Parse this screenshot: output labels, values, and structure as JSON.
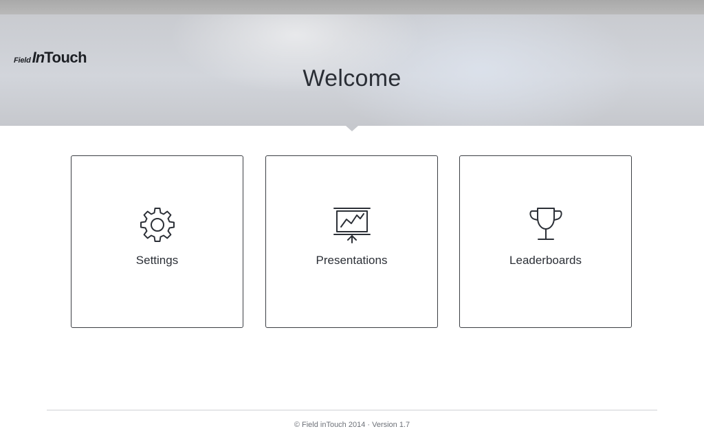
{
  "header": {
    "logo": {
      "field": "Field",
      "in": "In",
      "touch": "Touch"
    },
    "title": "Welcome"
  },
  "tiles": [
    {
      "label": "Settings",
      "icon": "gear-icon"
    },
    {
      "label": "Presentations",
      "icon": "presentation-chart-icon"
    },
    {
      "label": "Leaderboards",
      "icon": "trophy-icon"
    }
  ],
  "footer": {
    "text": "© Field inTouch 2014 · Version 1.7"
  },
  "colors": {
    "text": "#2b2f36",
    "tile_border": "#3a3d42",
    "footer_text": "#6d7178"
  }
}
